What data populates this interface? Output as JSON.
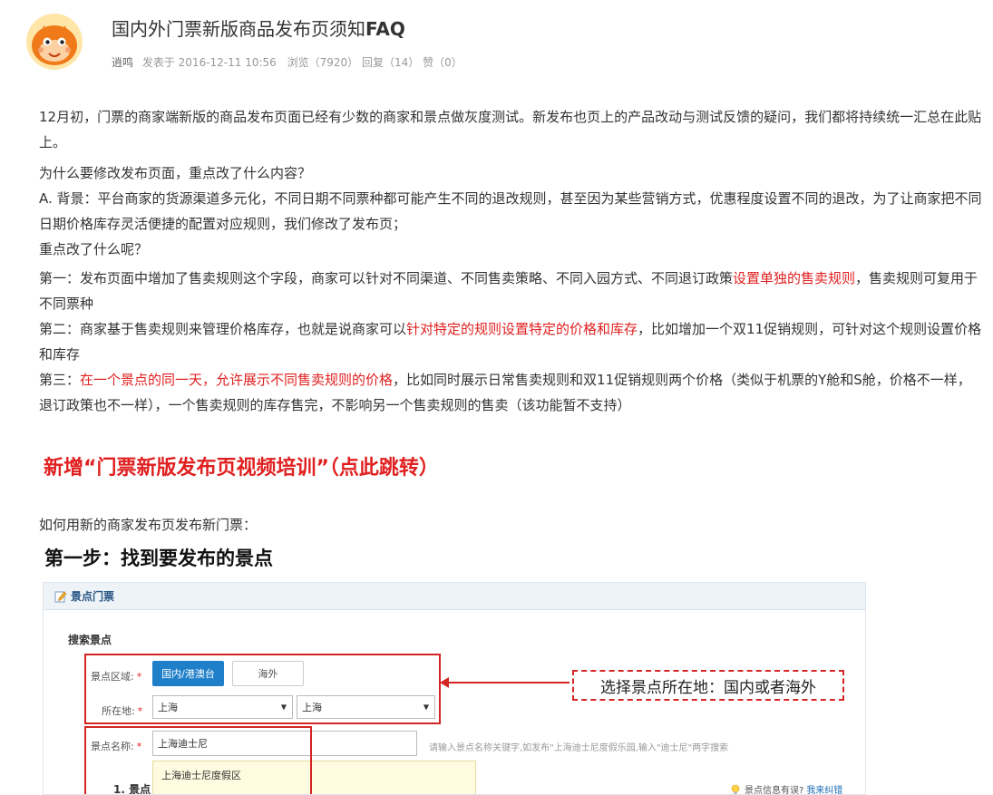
{
  "post": {
    "title_prefix": "国内外门票新版商品发布页须知",
    "title_suffix": "FAQ",
    "author": "逍鸣",
    "posted": "发表于 2016-12-11 10:56",
    "views": "浏览（7920）",
    "replies": "回复（14）",
    "likes": "赞（0）"
  },
  "content": {
    "intro": "12月初，门票的商家端新版的商品发布页面已经有少数的商家和景点做灰度测试。新发布也页上的产品改动与测试反馈的疑问，我们都将持续统一汇总在此贴上。",
    "q1": "为什么要修改发布页面，重点改了什么内容？",
    "a_background": "A.  背景：平台商家的货源渠道多元化，不同日期不同票种都可能产生不同的退改规则，甚至因为某些营销方式，优惠程度设置不同的退改，为了让商家把不同日期价格库存灵活便捷的配置对应规则，我们修改了发布页；",
    "key_changes": "重点改了什么呢？",
    "first_a": "第一：发布页面中增加了售卖规则这个字段，商家可以针对不同渠道、不同售卖策略、不同入园方式、不同退订政策",
    "first_red": "设置单独的售卖规则",
    "first_b": "，售卖规则可复用于不同票种",
    "second_a": "第二：商家基于售卖规则来管理价格库存，也就是说商家可以",
    "second_red": "针对特定的规则设置特定的价格和库存",
    "second_b": "，比如增加一个双11促销规则，可针对这个规则设置价格和库存",
    "third_a": "第三：",
    "third_red": "在一个景点的同一天，允许展示不同售卖规则的价格",
    "third_b": "，比如同时展示日常售卖规则和双11促销规则两个价格（类似于机票的Y舱和S舱，价格不一样，退订政策也不一样），一个售卖规则的库存售完，不影响另一个售卖规则的售卖（该功能暂不支持）",
    "promo_link": "新增“门票新版发布页视频培训”（点此跳转）",
    "howto": "如何用新的商家发布页发布新门票：",
    "step1_heading": "第一步：找到要发布的景点"
  },
  "screenshot": {
    "panel_title": "景点门票",
    "search_label": "搜索景点",
    "region_label": "景点区域:",
    "region_domestic": "国内/港澳台",
    "region_overseas": "海外",
    "location_label": "所在地:",
    "province": "上海",
    "city": "上海",
    "name_label": "景点名称:",
    "name_value": "上海迪士尼",
    "name_hint": "请输入景点名称关键字,如发布\"上海迪士尼度假乐园,输入\"迪士尼\"两字搜索",
    "suggestion": "上海迪士尼度假区",
    "step_partial": "1. 景点",
    "callout": "选择景点所在地：国内或者海外",
    "error_note": "景点信息有误?",
    "error_link": "我来纠错",
    "required_mark": "*"
  },
  "colors": {
    "highlight_red": "#e02020",
    "primary_blue": "#1f7fc9",
    "meta_gray": "#999999"
  }
}
